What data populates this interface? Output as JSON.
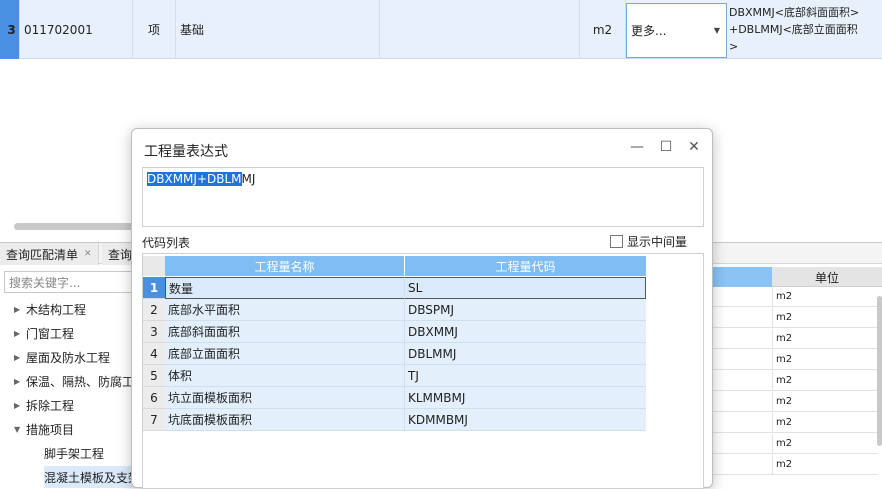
{
  "top_row": {
    "row_number": "3",
    "code": "011702001",
    "type": "项",
    "name": "基础",
    "unit": "m2",
    "combo_value": "更多...",
    "formula": "DBXMMJ<底部斜面面积>\n+DBLMMJ<底部立面面积\n>"
  },
  "tabs": [
    {
      "label": "查询匹配清单",
      "closable": true
    },
    {
      "label": "查询",
      "closable": false
    }
  ],
  "search": {
    "placeholder": "搜索关键字..."
  },
  "tree": [
    {
      "label": "木结构工程",
      "expanded": false
    },
    {
      "label": "门窗工程",
      "expanded": false
    },
    {
      "label": "屋面及防水工程",
      "expanded": false
    },
    {
      "label": "保温、隔热、防腐工",
      "expanded": false
    },
    {
      "label": "拆除工程",
      "expanded": false
    },
    {
      "label": "措施项目",
      "expanded": true
    },
    {
      "label": "脚手架工程",
      "child": true
    },
    {
      "label": "混凝土模板及支架",
      "child": true
    }
  ],
  "right_table": {
    "header": "单位",
    "units": [
      "m2",
      "m2",
      "m2",
      "m2",
      "m2",
      "m2",
      "m2",
      "m2",
      "m2"
    ]
  },
  "dialog": {
    "title": "工程量表达式",
    "expression_selected": "DBXMMJ+DBLM",
    "expression_rest": "MJ",
    "code_list_label": "代码列表",
    "show_intermediate_label": "显示中间量",
    "show_intermediate_checked": false,
    "columns": [
      "工程量名称",
      "工程量代码"
    ],
    "rows": [
      {
        "n": "1",
        "name": "数量",
        "code": "SL"
      },
      {
        "n": "2",
        "name": "底部水平面积",
        "code": "DBSPMJ"
      },
      {
        "n": "3",
        "name": "底部斜面面积",
        "code": "DBXMMJ"
      },
      {
        "n": "4",
        "name": "底部立面面积",
        "code": "DBLMMJ"
      },
      {
        "n": "5",
        "name": "体积",
        "code": "TJ"
      },
      {
        "n": "6",
        "name": "坑立面模板面积",
        "code": "KLMMBMJ"
      },
      {
        "n": "7",
        "name": "坑底面模板面积",
        "code": "KDMMBMJ"
      }
    ],
    "buttons": {
      "minimize": "—",
      "maximize": "☐",
      "close": "✕"
    }
  },
  "colors": {
    "accent": "#4a90e2",
    "header_blue": "#7fbdf2",
    "selection": "#1e74d9"
  }
}
